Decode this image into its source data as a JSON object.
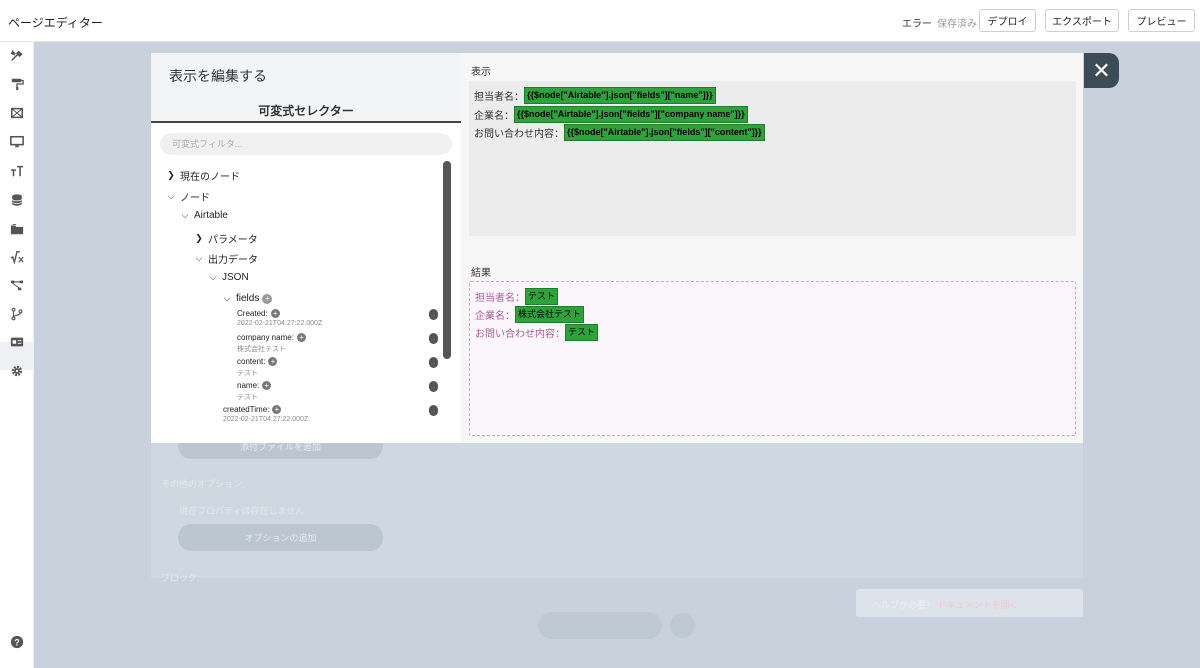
{
  "app": {
    "title": "ページエディター"
  },
  "topbar": {
    "status_error": "エラー",
    "status_saved": "保存済み",
    "deploy_label": "デプロイ",
    "export_label": "エクスポート",
    "preview_label": "プレビュー"
  },
  "rail": {
    "icons": [
      "tools-icon",
      "paint-roller-icon",
      "layout-icon",
      "monitor-icon",
      "text-size-icon",
      "database-icon",
      "folder-icon",
      "formula-icon",
      "workflow-icon",
      "branch-icon",
      "id-card-icon",
      "gear-icon"
    ],
    "help_icon": "help-icon"
  },
  "background": {
    "attach_button": "添付ファイルを追加",
    "other_options_label": "その他のオプション:",
    "no_properties": "現在プロパティは存在しません",
    "add_option_button": "オプションの追加",
    "block_label": "ブロック:",
    "help_text": "ヘルプが必要？",
    "help_link": "ドキュメントを開く"
  },
  "modal": {
    "title": "表示を編集する",
    "selector_title": "可変式セレクター",
    "filter_placeholder": "可変式フィルタ...",
    "tree": {
      "current_node": "現在のノード",
      "nodes": "ノード",
      "airtable": "Airtable",
      "parameters": "パラメータ",
      "output_data": "出力データ",
      "json": "JSON",
      "fields": "fields",
      "leaves": [
        {
          "key": "Created:",
          "value": "2022-02-21T04:27:22.000Z"
        },
        {
          "key": "company name:",
          "value": "株式会社テスト"
        },
        {
          "key": "content:",
          "value": "テスト"
        },
        {
          "key": "name:",
          "value": "テスト"
        }
      ],
      "created_time": {
        "key": "createdTime:",
        "value": "2022-02-21T04:27:22.000Z"
      }
    },
    "display_label": "表示",
    "expressions": [
      {
        "label": "担当者名：",
        "expr": "{{$node[\"Airtable\"].json[\"fields\"][\"name\"]}}"
      },
      {
        "label": "企業名：",
        "expr": "{{$node[\"Airtable\"].json[\"fields\"][\"company name\"]}}"
      },
      {
        "label": "お問い合わせ内容：",
        "expr": "{{$node[\"Airtable\"].json[\"fields\"][\"content\"]}}"
      }
    ],
    "result_label": "結果",
    "results": [
      {
        "label": "担当者名：",
        "value": "テスト"
      },
      {
        "label": "企業名：",
        "value": "株式会社テスト"
      },
      {
        "label": "お問い合わせ内容：",
        "value": "テスト"
      }
    ],
    "close_icon": "close-icon"
  },
  "colors": {
    "highlight_green": "#2ea33b",
    "backdrop": "#c9d2dc",
    "close_button": "#3d4b57",
    "result_label": "#a85f9a"
  }
}
